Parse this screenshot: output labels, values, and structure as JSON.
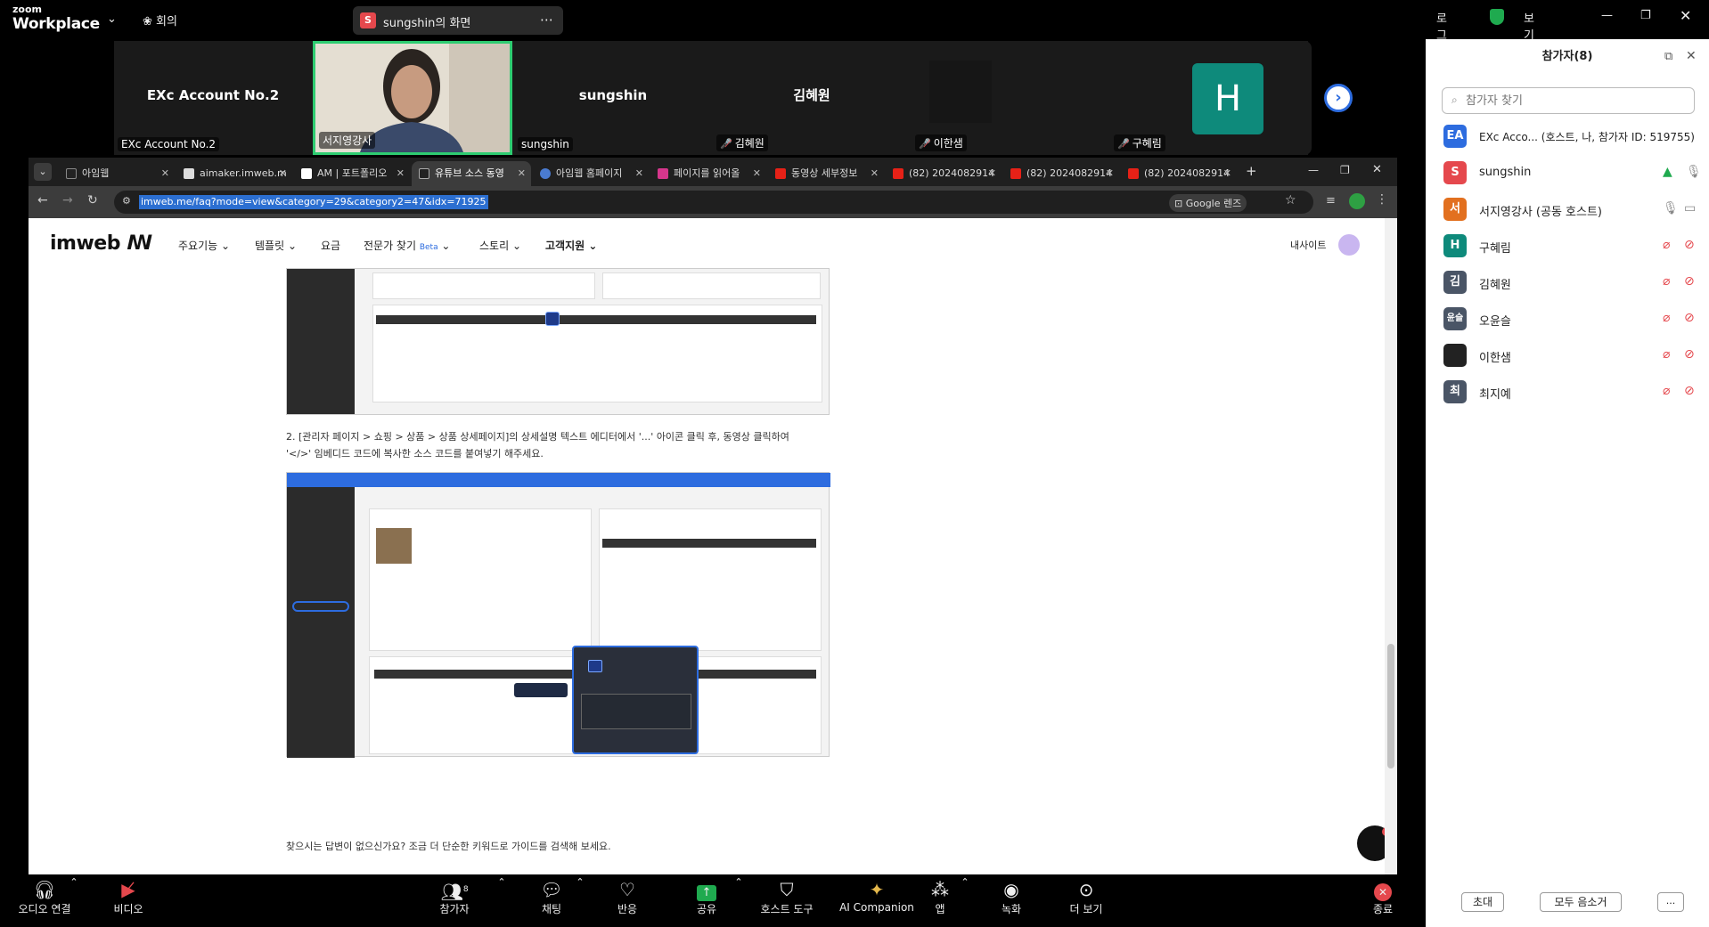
{
  "topbar": {
    "logo_line1": "zoom",
    "logo_line2": "Workplace",
    "meeting_label": "회의",
    "share_badge": "S",
    "share_title": "sungshin의 화면",
    "login": "로그인",
    "view": "보기"
  },
  "strip": {
    "tiles": [
      {
        "name": "EXc Account No.2",
        "label": "EXc Account No.2"
      },
      {
        "name": "",
        "label": "서지영강사"
      },
      {
        "name": "sungshin",
        "label": "sungshin"
      },
      {
        "name": "김혜원",
        "label": "김혜원"
      },
      {
        "name": "",
        "label": "이한샘"
      },
      {
        "name": "H",
        "label": "구혜림"
      }
    ]
  },
  "browser": {
    "tabs": [
      {
        "label": "아임웹",
        "color": "#222"
      },
      {
        "label": "aimaker.imweb.m",
        "color": "#ddd"
      },
      {
        "label": "AM | 포트폴리오",
        "color": "#fff"
      },
      {
        "label": "유튜브 소스 동영",
        "color": "#222"
      },
      {
        "label": "아임웹 홈페이지",
        "color": "#4a7bd0"
      },
      {
        "label": "페이지를 읽어올",
        "color": "#d6368c"
      },
      {
        "label": "동영상 세부정보",
        "color": "#e62117"
      },
      {
        "label": "(82) 2024082914",
        "color": "#e62117"
      },
      {
        "label": "(82) 2024082914",
        "color": "#e62117"
      },
      {
        "label": "(82) 2024082914",
        "color": "#e62117"
      }
    ],
    "url": "imweb.me/faq?mode=view&category=29&category2=47&idx=71925",
    "lens": "Google 렌즈"
  },
  "page": {
    "brand": "imweb",
    "nav": [
      "주요기능",
      "템플릿",
      "요금",
      "전문가 찾기",
      "스토리",
      "고객지원"
    ],
    "beta": "Beta",
    "mysite": "내사이트",
    "instruction_line1": "2. [관리자 페이지 > 쇼핑 > 상품 > 상품 상세페이지]의 상세설명 텍스트 에디터에서 '...' 아이콘 클릭 후, 동영상 클릭하여",
    "instruction_line2": "'</>' 임베디드 코드에 복사한 소스 코드를 붙여넣기 해주세요.",
    "footer_text": "찾으시는 답변이 없으신가요? 조금 더 단순한 키워드로 가이드를 검색해 보세요."
  },
  "panel": {
    "title": "참가자(8)",
    "search_placeholder": "참가자 찾기",
    "participants": [
      {
        "initials": "EA",
        "name": "EXc Acco... (호스트, 나, 참가자 ID: 519755)",
        "color": "#2d6cdf"
      },
      {
        "initials": "S",
        "name": "sungshin",
        "color": "#e5484d"
      },
      {
        "initials": "서",
        "name": "서지영강사 (공동 호스트)",
        "color": "#e2701f"
      },
      {
        "initials": "H",
        "name": "구혜림",
        "color": "#0e8a7b"
      },
      {
        "initials": "김",
        "name": "김혜원",
        "color": "#4a5566"
      },
      {
        "initials": "윤슬",
        "name": "오윤슬",
        "color": "#4a5566"
      },
      {
        "initials": "",
        "name": "이한샘",
        "color": "#222222"
      },
      {
        "initials": "최",
        "name": "최지예",
        "color": "#4a5566"
      }
    ],
    "invite": "초대",
    "mute_all": "모두 음소거",
    "more": "..."
  },
  "toolbar": {
    "audio": "오디오 연결",
    "video": "비디오",
    "participants": "참가자",
    "participant_count": "8",
    "chat": "채팅",
    "react": "반응",
    "share": "공유",
    "host_tools": "호스트 도구",
    "companion": "AI Companion",
    "apps": "앱",
    "record": "녹화",
    "more": "더 보기",
    "end": "종료"
  }
}
